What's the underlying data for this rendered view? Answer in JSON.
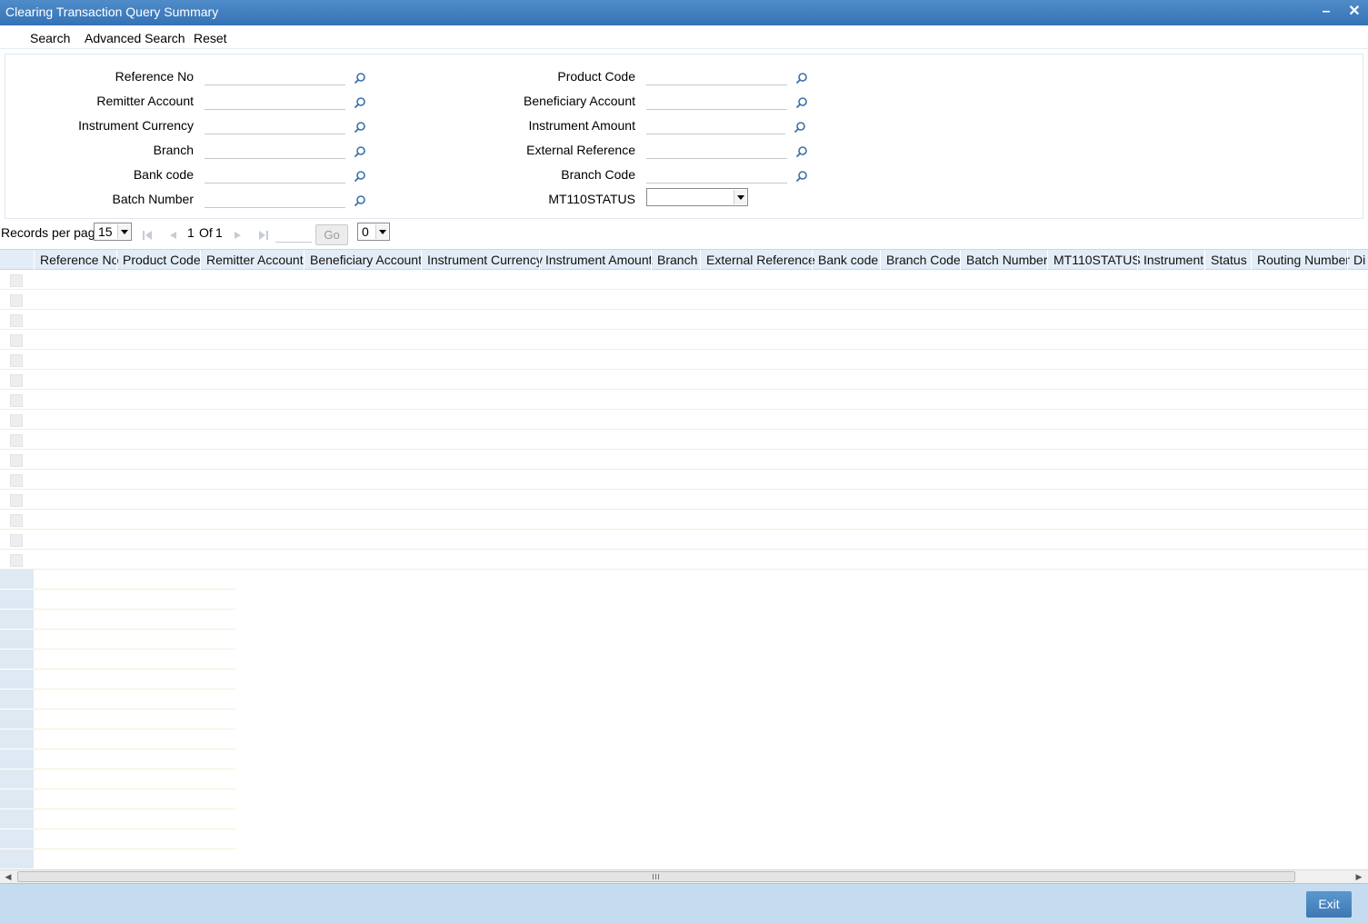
{
  "window": {
    "title": "Clearing Transaction Query Summary",
    "minimize_icon": "minimize-icon",
    "close_icon": "close-icon"
  },
  "menu": {
    "search": "Search",
    "advanced_search": "Advanced Search",
    "reset": "Reset"
  },
  "criteria": {
    "left": [
      {
        "label": "Reference No",
        "value": ""
      },
      {
        "label": "Remitter Account",
        "value": ""
      },
      {
        "label": "Instrument Currency",
        "value": ""
      },
      {
        "label": "Branch",
        "value": ""
      },
      {
        "label": "Bank code",
        "value": ""
      },
      {
        "label": "Batch Number",
        "value": ""
      }
    ],
    "right": [
      {
        "label": "Product Code",
        "value": ""
      },
      {
        "label": "Beneficiary Account",
        "value": ""
      },
      {
        "label": "Instrument Amount",
        "value": ""
      },
      {
        "label": "External Reference",
        "value": ""
      },
      {
        "label": "Branch Code",
        "value": ""
      },
      {
        "label": "MT110STATUS",
        "value": ""
      }
    ],
    "lookup_icon": "search-icon"
  },
  "pager": {
    "records_label": "Records per page",
    "records_per_page": "15",
    "current_page": "1",
    "of_label": "Of",
    "total_pages": "1",
    "go_label": "Go",
    "page_select": "0"
  },
  "grid": {
    "columns": [
      "Reference No",
      "Product Code",
      "Remitter Account",
      "Beneficiary Account",
      "Instrument Currency",
      "Instrument Amount",
      "Branch",
      "External Reference",
      "Bank code",
      "Branch Code",
      "Batch Number",
      "MT110STATUS",
      "Instrument",
      "Status",
      "Routing Number",
      "Di"
    ],
    "rows": []
  },
  "footer": {
    "exit_label": "Exit"
  }
}
